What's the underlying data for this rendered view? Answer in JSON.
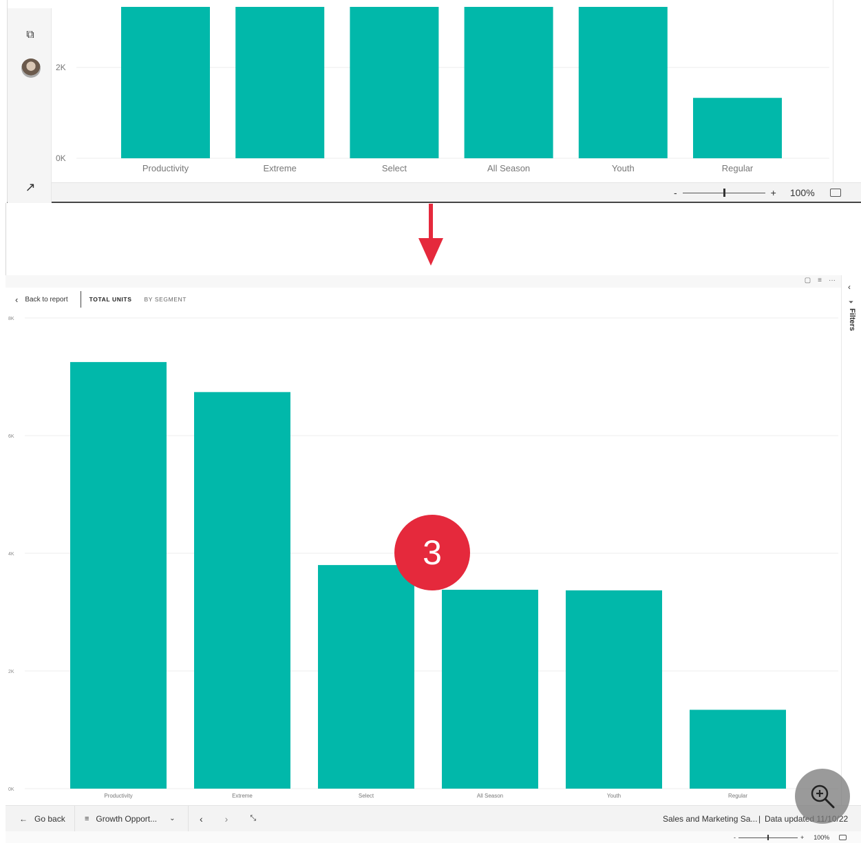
{
  "top_visual": {
    "chart_data": {
      "type": "bar",
      "categories": [
        "Productivity",
        "Extreme",
        "Select",
        "All Season",
        "Youth",
        "Regular"
      ],
      "values": [
        null,
        null,
        null,
        null,
        null,
        1330
      ],
      "visible_ylim": [
        0,
        3300
      ],
      "ytick_values": [
        0,
        2000
      ],
      "ytick_labels": [
        "0K",
        "2K"
      ],
      "bar_color": "#01b8aa",
      "note_visible_clipping": "bars extend above the cropped top edge",
      "grid": true
    },
    "zoom": {
      "minus": "-",
      "plus": "+",
      "percent": "100%",
      "level": 0.5
    }
  },
  "focus_visual": {
    "back_label": "Back to report",
    "tabs": [
      {
        "label": "TOTAL UNITS",
        "active": true
      },
      {
        "label": "BY SEGMENT",
        "active": false
      }
    ],
    "filters_label": "Filters",
    "chart_data": {
      "type": "bar",
      "categories": [
        "Productivity",
        "Extreme",
        "Select",
        "All Season",
        "Youth",
        "Regular"
      ],
      "values": [
        7250,
        6740,
        3800,
        3380,
        3370,
        1340
      ],
      "ylim": [
        0,
        8000
      ],
      "ytick_values": [
        0,
        2000,
        4000,
        6000,
        8000
      ],
      "ytick_labels": [
        "0K",
        "2K",
        "4K",
        "6K",
        "8K"
      ],
      "bar_color": "#01b8aa",
      "title": "",
      "xlabel": "",
      "ylabel": "",
      "grid": true
    }
  },
  "bottom_nav": {
    "go_back": "Go back",
    "page_name": "Growth Opport...",
    "report_name": "Sales and Marketing Sa...",
    "data_updated": "Data updated 11/10/22"
  },
  "bottom_zoom": {
    "minus": "-",
    "plus": "+",
    "percent": "100%",
    "level": 0.5
  },
  "annotation": {
    "step_number": "3"
  },
  "colors": {
    "accent": "#e5293c",
    "bar": "#01b8aa",
    "gridline": "#ececec"
  }
}
